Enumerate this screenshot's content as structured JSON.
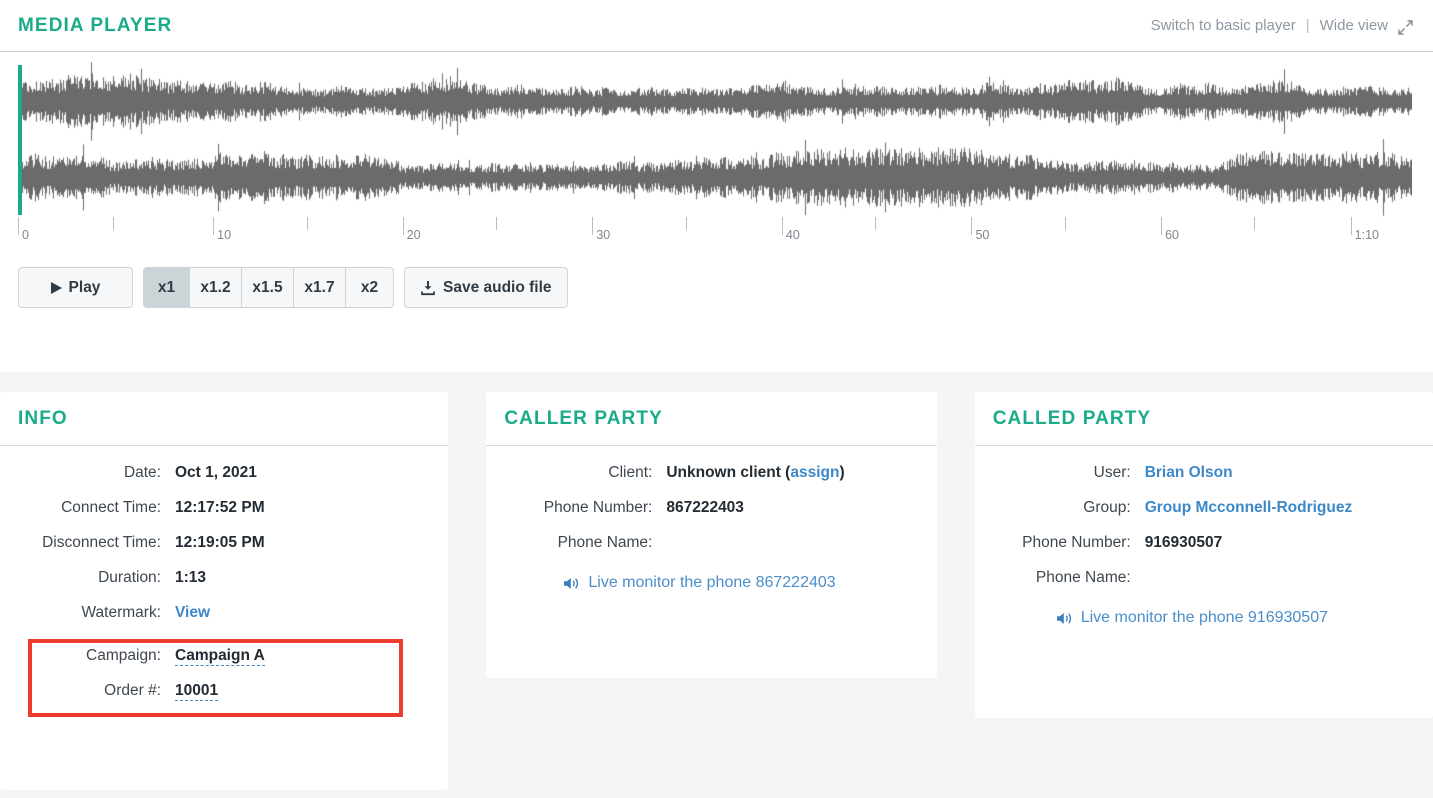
{
  "header": {
    "title": "MEDIA PLAYER",
    "switch_link": "Switch to basic player",
    "separator": "|",
    "wide_view": "Wide view",
    "expand_icon": "expand-arrows-icon"
  },
  "player": {
    "timeline": {
      "labels": [
        "0",
        "10",
        "20",
        "30",
        "40",
        "50",
        "60",
        "1:10"
      ],
      "label_positions_pct": [
        0.0,
        14.0,
        27.6,
        41.2,
        54.8,
        68.4,
        82.0,
        95.6
      ],
      "minor_positions_pct": [
        6.8,
        20.7,
        34.3,
        47.9,
        61.5,
        75.1,
        88.7
      ],
      "playhead_position_pct": 0
    },
    "controls": {
      "play_label": "Play",
      "play_icon": "play-triangle-icon",
      "speeds": [
        "x1",
        "x1.2",
        "x1.5",
        "x1.7",
        "x2"
      ],
      "active_speed": "x1",
      "save_label": "Save audio file",
      "save_icon": "download-icon"
    },
    "waveform": {
      "channels": 2,
      "color": "#6b6b6b"
    }
  },
  "panels": {
    "info": {
      "title": "INFO",
      "rows": [
        {
          "label": "Date:",
          "value": "Oct 1, 2021",
          "style": "bold"
        },
        {
          "label": "Connect Time:",
          "value": "12:17:52 PM",
          "style": "bold"
        },
        {
          "label": "Disconnect Time:",
          "value": "12:19:05 PM",
          "style": "bold"
        },
        {
          "label": "Duration:",
          "value": "1:13",
          "style": "bold"
        },
        {
          "label": "Watermark:",
          "value": "View",
          "style": "link"
        }
      ],
      "highlighted_rows": [
        {
          "label": "Campaign:",
          "value": "Campaign A",
          "style": "editable"
        },
        {
          "label": "Order #:",
          "value": "10001",
          "style": "editable"
        }
      ],
      "highlight_color": "#ee3b2f"
    },
    "caller": {
      "title": "CALLER PARTY",
      "rows": [
        {
          "label": "Client:",
          "value": "Unknown client",
          "suffix_link": "assign"
        },
        {
          "label": "Phone Number:",
          "value": "867222403"
        },
        {
          "label": "Phone Name:",
          "value": ""
        }
      ],
      "monitor_link": "Live monitor the phone 867222403",
      "monitor_icon": "speaker-icon"
    },
    "called": {
      "title": "CALLED PARTY",
      "rows": [
        {
          "label": "User:",
          "value": "Brian Olson",
          "style": "link"
        },
        {
          "label": "Group:",
          "value": "Group Mcconnell-Rodriguez",
          "style": "link"
        },
        {
          "label": "Phone Number:",
          "value": "916930507",
          "style": "bold"
        },
        {
          "label": "Phone Name:",
          "value": ""
        }
      ],
      "monitor_link": "Live monitor the phone 916930507",
      "monitor_icon": "speaker-icon"
    }
  },
  "colors": {
    "accent_teal": "#1aab8a",
    "link_blue": "#3c88c8",
    "highlight_red": "#ee3b2f",
    "page_bg": "#f4f5f7"
  }
}
